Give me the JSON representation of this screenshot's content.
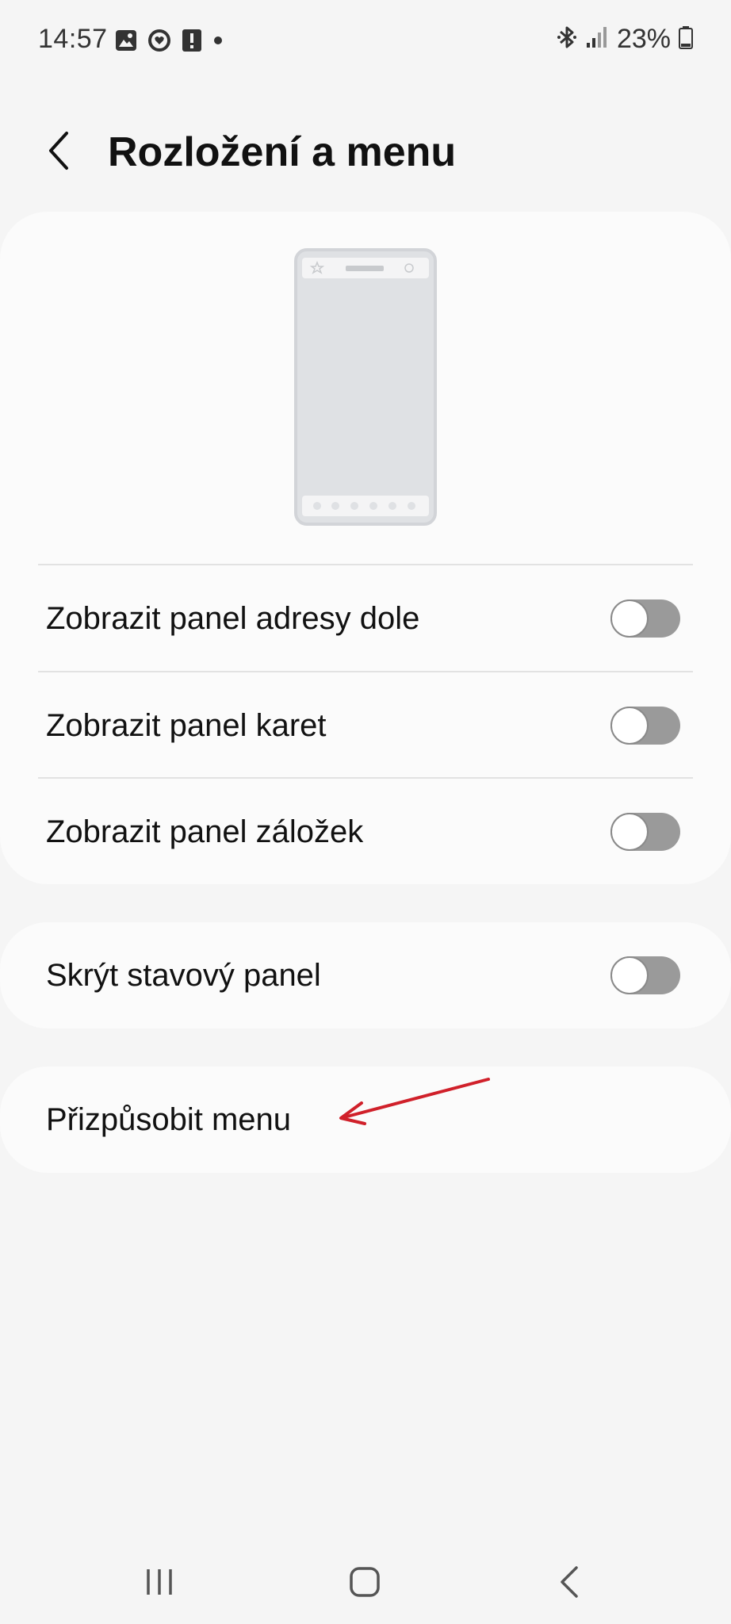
{
  "status_bar": {
    "time": "14:57",
    "left_icons": [
      "gallery-icon",
      "health-icon",
      "alert-icon",
      "dot-icon"
    ],
    "right_icons": [
      "bluetooth-icon",
      "signal-icon",
      "battery-icon"
    ],
    "battery_percent": "23%"
  },
  "app_bar": {
    "title": "Rozložení a menu",
    "back_icon": "back-arrow-icon"
  },
  "layout_section": {
    "preview_icon": "phone-preview-icon",
    "options": [
      {
        "label": "Zobrazit panel adresy dole",
        "enabled": false
      },
      {
        "label": "Zobrazit panel karet",
        "enabled": false
      },
      {
        "label": "Zobrazit panel záložek",
        "enabled": false
      }
    ]
  },
  "status_section": {
    "label": "Skrýt stavový panel",
    "enabled": false
  },
  "menu_section": {
    "label": "Přizpůsobit menu"
  },
  "colors": {
    "background": "#f5f5f5",
    "card": "#fbfbfb",
    "toggle_off": "#9a9a9a",
    "annotation_arrow": "#d0202a"
  },
  "nav_bar": {
    "buttons": [
      "recent-apps-icon",
      "home-icon",
      "back-icon"
    ]
  }
}
